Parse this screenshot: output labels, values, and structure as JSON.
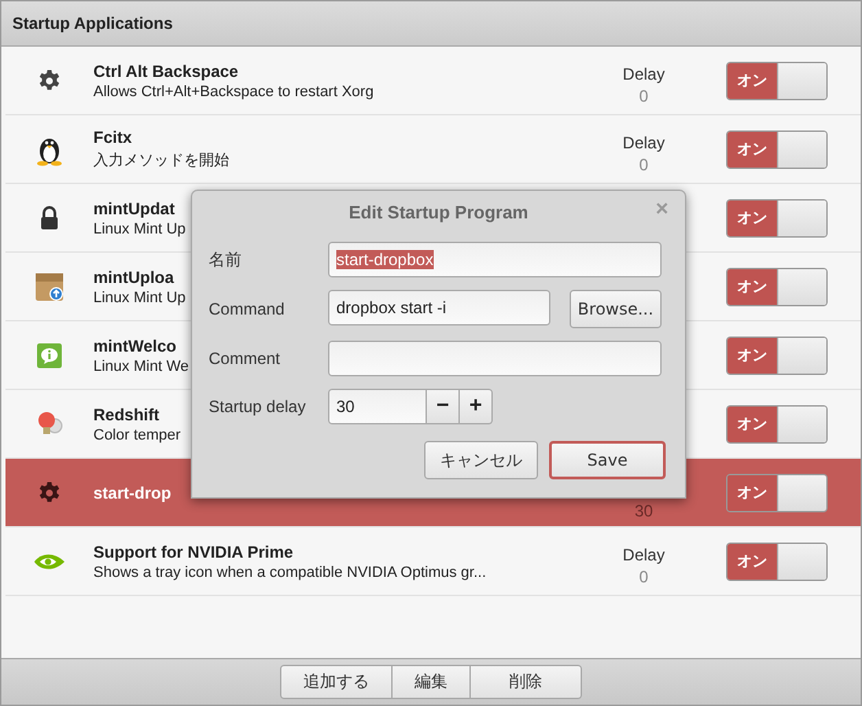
{
  "window": {
    "title": "Startup Applications"
  },
  "apps": [
    {
      "kind": "gear",
      "name": "Ctrl Alt Backspace",
      "description": "Allows Ctrl+Alt+Backspace to restart Xorg",
      "delay_label": "Delay",
      "delay": "0",
      "on": true,
      "toggle_label": "オン",
      "selected": false
    },
    {
      "kind": "penguin",
      "name": "Fcitx",
      "description": "入力メソッドを開始",
      "delay_label": "Delay",
      "delay": "0",
      "on": true,
      "toggle_label": "オン",
      "selected": false
    },
    {
      "kind": "lock",
      "name": "mintUpdat",
      "description": "Linux Mint Up",
      "on": true,
      "toggle_label": "オン",
      "selected": false
    },
    {
      "kind": "package",
      "name": "mintUploa",
      "description": "Linux Mint Up",
      "on": true,
      "toggle_label": "オン",
      "selected": false
    },
    {
      "kind": "info",
      "name": "mintWelco",
      "description": "Linux Mint We",
      "on": true,
      "toggle_label": "オン",
      "selected": false
    },
    {
      "kind": "bulb",
      "name": "Redshift",
      "description": "Color temper",
      "on": true,
      "toggle_label": "オン",
      "selected": false
    },
    {
      "kind": "gear",
      "name": "start-drop",
      "delay": "30",
      "on": true,
      "toggle_label": "オン",
      "selected": true
    },
    {
      "kind": "eye",
      "name": "Support for NVIDIA Prime",
      "description": "Shows a tray icon when a compatible NVIDIA Optimus gr...",
      "delay_label": "Delay",
      "delay": "0",
      "on": true,
      "toggle_label": "オン",
      "selected": false
    }
  ],
  "toolbar": {
    "buttons": [
      "追加する",
      "編集",
      "削除"
    ]
  },
  "dialog": {
    "title": "Edit Startup Program",
    "close": "×",
    "name_label": "名前",
    "name_value": "start-dropbox",
    "command_label": "Command",
    "command_value": "dropbox start -i",
    "browse": "Browse...",
    "comment_label": "Comment",
    "delay_label": "Startup delay",
    "delay_value": "30",
    "minus": "−",
    "plus": "+",
    "cancel": "キャンセル",
    "save": "Save"
  }
}
